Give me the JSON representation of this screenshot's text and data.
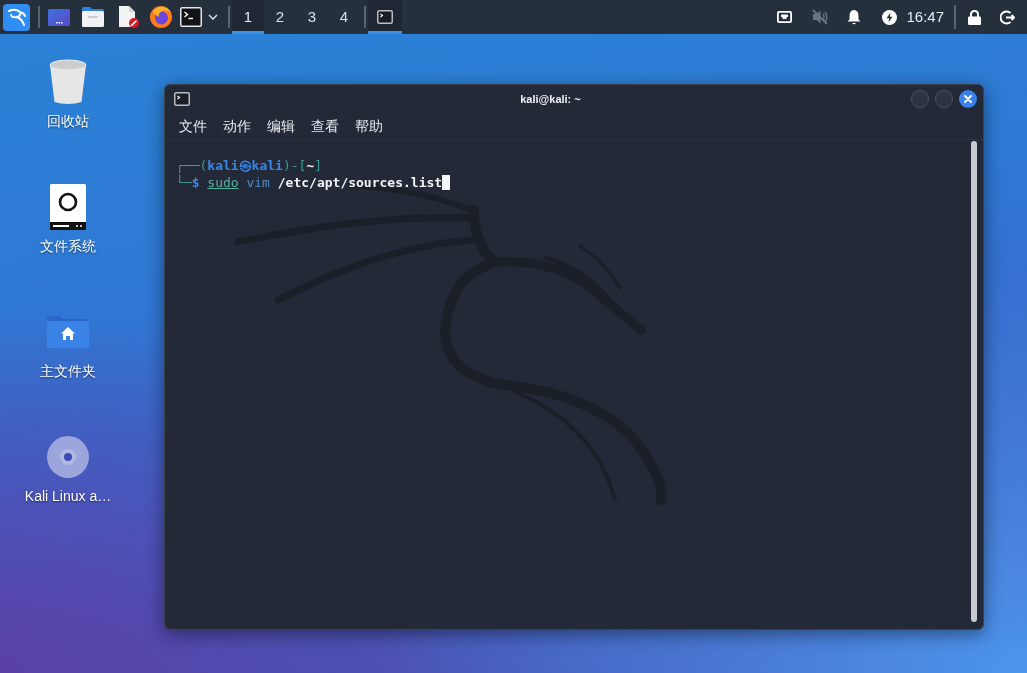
{
  "taskbar": {
    "workspaces": [
      {
        "label": "1",
        "selected": true
      },
      {
        "label": "2",
        "selected": false
      },
      {
        "label": "3",
        "selected": false
      },
      {
        "label": "4",
        "selected": false
      }
    ],
    "tasks": [
      {
        "selected": true
      }
    ],
    "volume": {
      "muted": true
    },
    "clock": "16:47"
  },
  "desktop_icons": [
    {
      "kind": "trash",
      "label": "回收站"
    },
    {
      "kind": "drive",
      "label": "文件系统"
    },
    {
      "kind": "home",
      "label": "主文件夹"
    },
    {
      "kind": "disc",
      "label": "Kali Linux a…"
    }
  ],
  "terminal": {
    "title": "kali@kali: ~",
    "menu": [
      "文件",
      "动作",
      "编辑",
      "查看",
      "帮助"
    ],
    "lines": [
      {
        "segments": [
          {
            "text": "┌──(",
            "kind": "frame"
          },
          {
            "text": "kali㉿kali",
            "kind": "user"
          },
          {
            "text": ")-[",
            "kind": "frame"
          },
          {
            "text": "~",
            "kind": "cwd"
          },
          {
            "text": "]",
            "kind": "frame"
          }
        ],
        "cursor": false
      },
      {
        "segments": [
          {
            "text": "└─",
            "kind": "frame"
          },
          {
            "text": "$ ",
            "kind": "prompt"
          },
          {
            "text": "sudo",
            "kind": "precommand"
          },
          {
            "text": " vim ",
            "kind": "command"
          },
          {
            "text": "/etc/apt/sources.list",
            "kind": "path"
          }
        ],
        "cursor": true
      }
    ]
  }
}
